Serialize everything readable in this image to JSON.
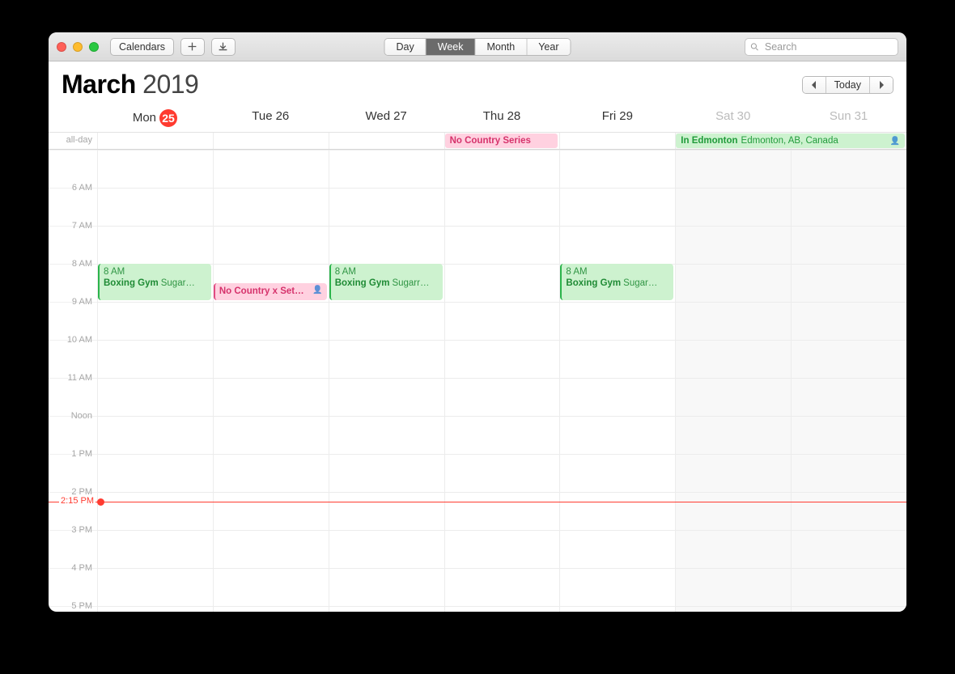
{
  "titlebar": {
    "calendars_label": "Calendars"
  },
  "view_tabs": [
    "Day",
    "Week",
    "Month",
    "Year"
  ],
  "view_active": "Week",
  "search": {
    "placeholder": "Search"
  },
  "header": {
    "month": "March",
    "year": "2019",
    "today_label": "Today"
  },
  "days": [
    {
      "name": "Mon",
      "num": "25",
      "today": true,
      "weekend": false
    },
    {
      "name": "Tue",
      "num": "26",
      "today": false,
      "weekend": false
    },
    {
      "name": "Wed",
      "num": "27",
      "today": false,
      "weekend": false
    },
    {
      "name": "Thu",
      "num": "28",
      "today": false,
      "weekend": false
    },
    {
      "name": "Fri",
      "num": "29",
      "today": false,
      "weekend": false
    },
    {
      "name": "Sat",
      "num": "30",
      "today": false,
      "weekend": true
    },
    {
      "name": "Sun",
      "num": "31",
      "today": false,
      "weekend": true
    }
  ],
  "allday_label": "all-day",
  "allday_events": [
    {
      "day_start": 3,
      "day_span": 1,
      "title": "No Country Series",
      "location": "",
      "color": "pink"
    },
    {
      "day_start": 5,
      "day_span": 2,
      "title": "In Edmonton",
      "location": "Edmonton, AB, Canada",
      "color": "green",
      "shared": true
    }
  ],
  "hour_height": 47,
  "visible_start_hour": 5,
  "time_labels": [
    "",
    "6 AM",
    "7 AM",
    "8 AM",
    "9 AM",
    "10 AM",
    "11 AM",
    "Noon",
    "1 PM",
    "2 PM",
    "3 PM",
    "4 PM",
    "5 PM"
  ],
  "now": {
    "label": "2:15 PM",
    "hour": 14.25
  },
  "timed_events": [
    {
      "day": 0,
      "start": 8,
      "end": 9,
      "title": "Boxing Gym",
      "time_label": "8 AM",
      "location": "Sugar…",
      "color": "green"
    },
    {
      "day": 1,
      "start": 8.5,
      "end": 9,
      "title": "No Country x Set…",
      "time_label": "",
      "location": "",
      "color": "pink",
      "shared": true
    },
    {
      "day": 2,
      "start": 8,
      "end": 9,
      "title": "Boxing Gym",
      "time_label": "8 AM",
      "location": "Sugarr…",
      "color": "green"
    },
    {
      "day": 4,
      "start": 8,
      "end": 9,
      "title": "Boxing Gym",
      "time_label": "8 AM",
      "location": "Sugar…",
      "color": "green"
    }
  ]
}
